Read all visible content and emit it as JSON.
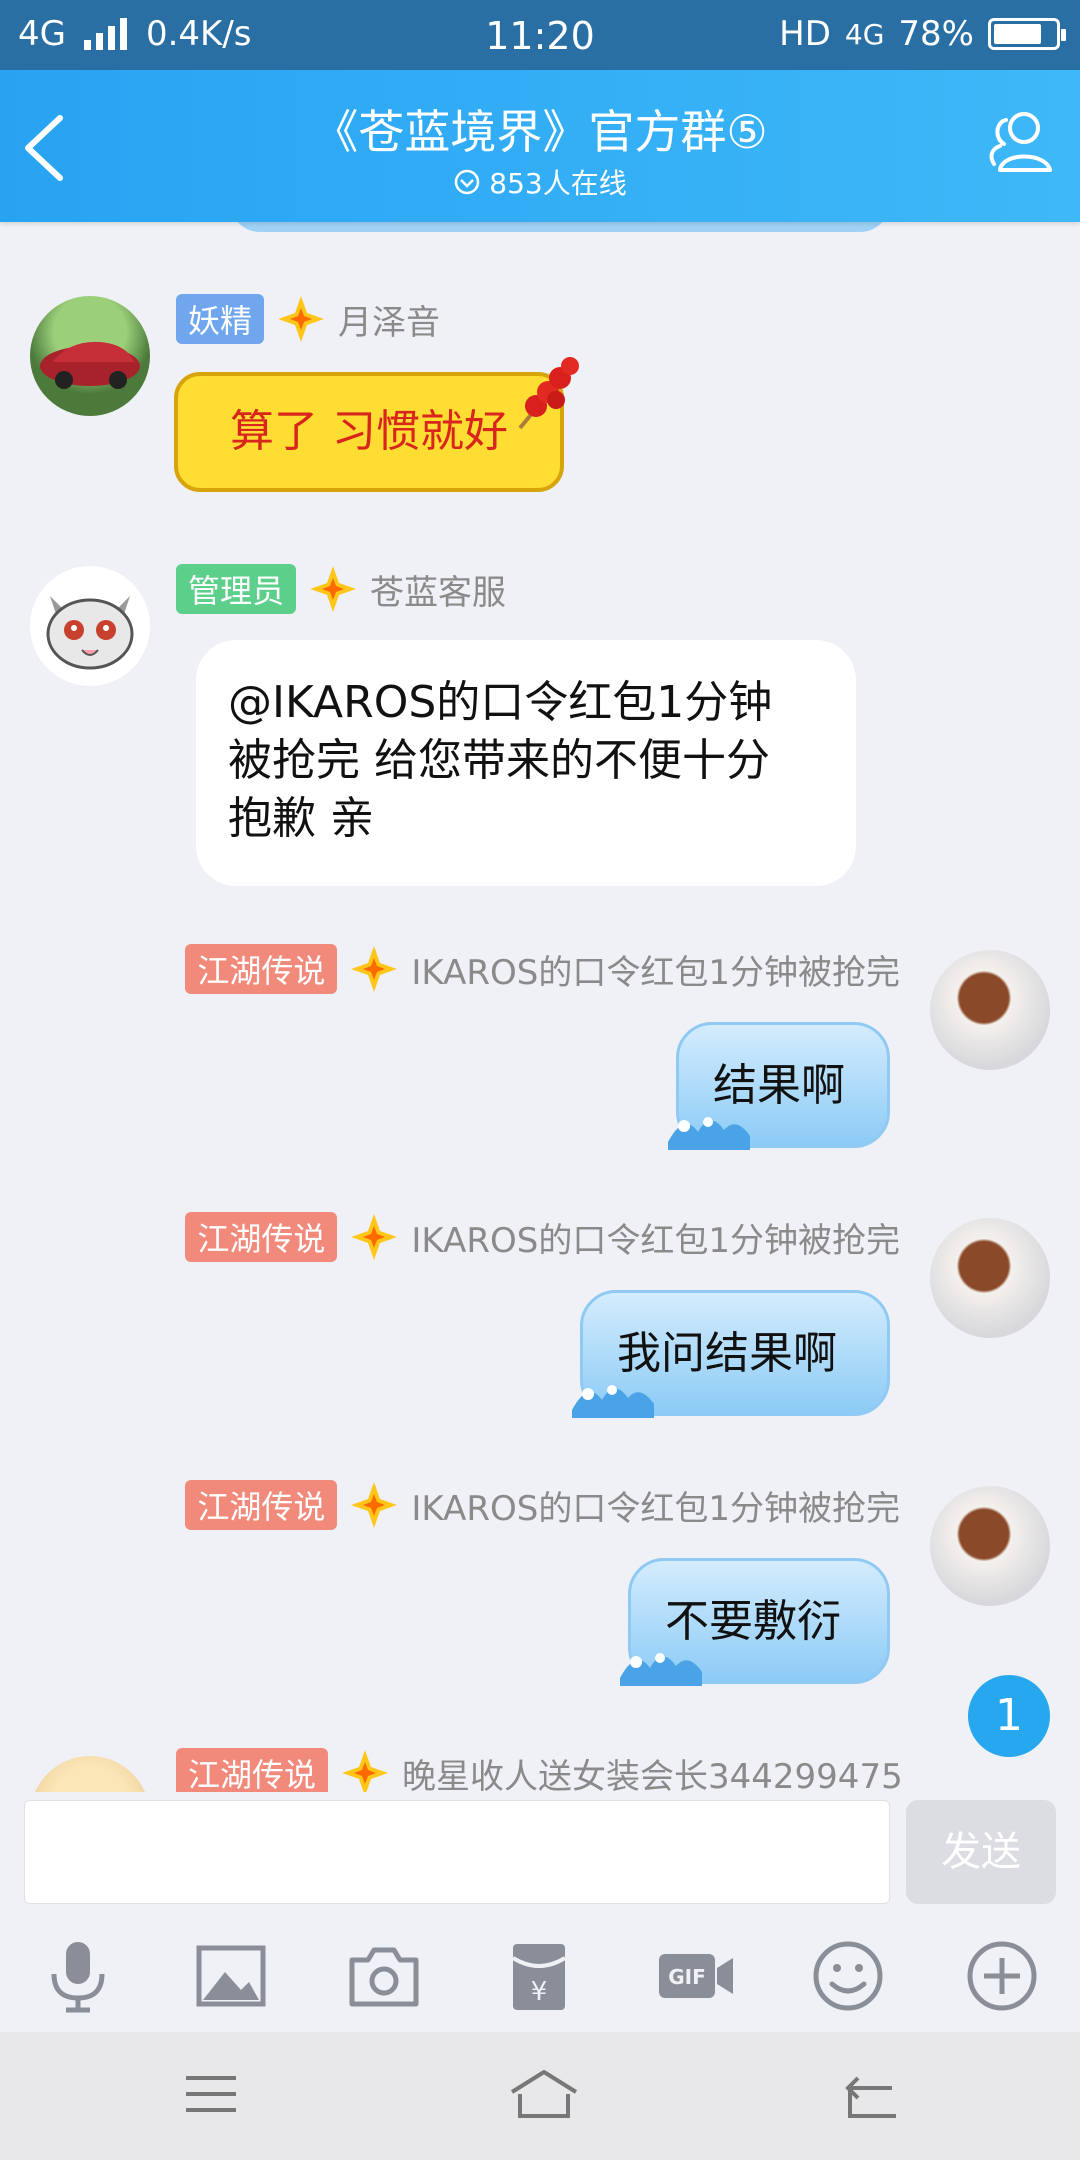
{
  "status_bar": {
    "network": "4G",
    "speed": "0.4K/s",
    "time": "11:20",
    "hd": "HD",
    "net_type": "4G",
    "battery": "78%",
    "battery_level": 0.78
  },
  "header": {
    "title": "《苍蓝境界》官方群⑤",
    "online": "853人在线"
  },
  "messages": [
    {
      "badge": "妖精",
      "badge_color": "#6fa6ee",
      "sender": "月泽音",
      "text": "算了 习惯就好"
    },
    {
      "badge": "管理员",
      "badge_color": "#5ccf8a",
      "sender": "苍蓝客服",
      "text_lines": [
        "@IKAROS的口令红包1分钟",
        "被抢完 给您带来的不便十分",
        "抱歉 亲"
      ]
    },
    {
      "badge": "江湖传说",
      "badge_color": "#f28a7b",
      "sender": "IKAROS的口令红包1分钟被抢完",
      "text": "结果啊"
    },
    {
      "badge": "江湖传说",
      "badge_color": "#f28a7b",
      "sender": "IKAROS的口令红包1分钟被抢完",
      "text": "我问结果啊"
    },
    {
      "badge": "江湖传说",
      "badge_color": "#f28a7b",
      "sender": "IKAROS的口令红包1分钟被抢完",
      "text": "不要敷衍"
    },
    {
      "badge": "江湖传说",
      "badge_color": "#f28a7b",
      "sender": "晚星收人送女装会长344299475"
    }
  ],
  "unread_count": "1",
  "input": {
    "placeholder": "",
    "send_label": "发送"
  },
  "toolbar_icons": [
    "microphone-icon",
    "image-icon",
    "camera-icon",
    "red-packet-icon",
    "gif-icon",
    "emoji-icon",
    "plus-icon"
  ]
}
